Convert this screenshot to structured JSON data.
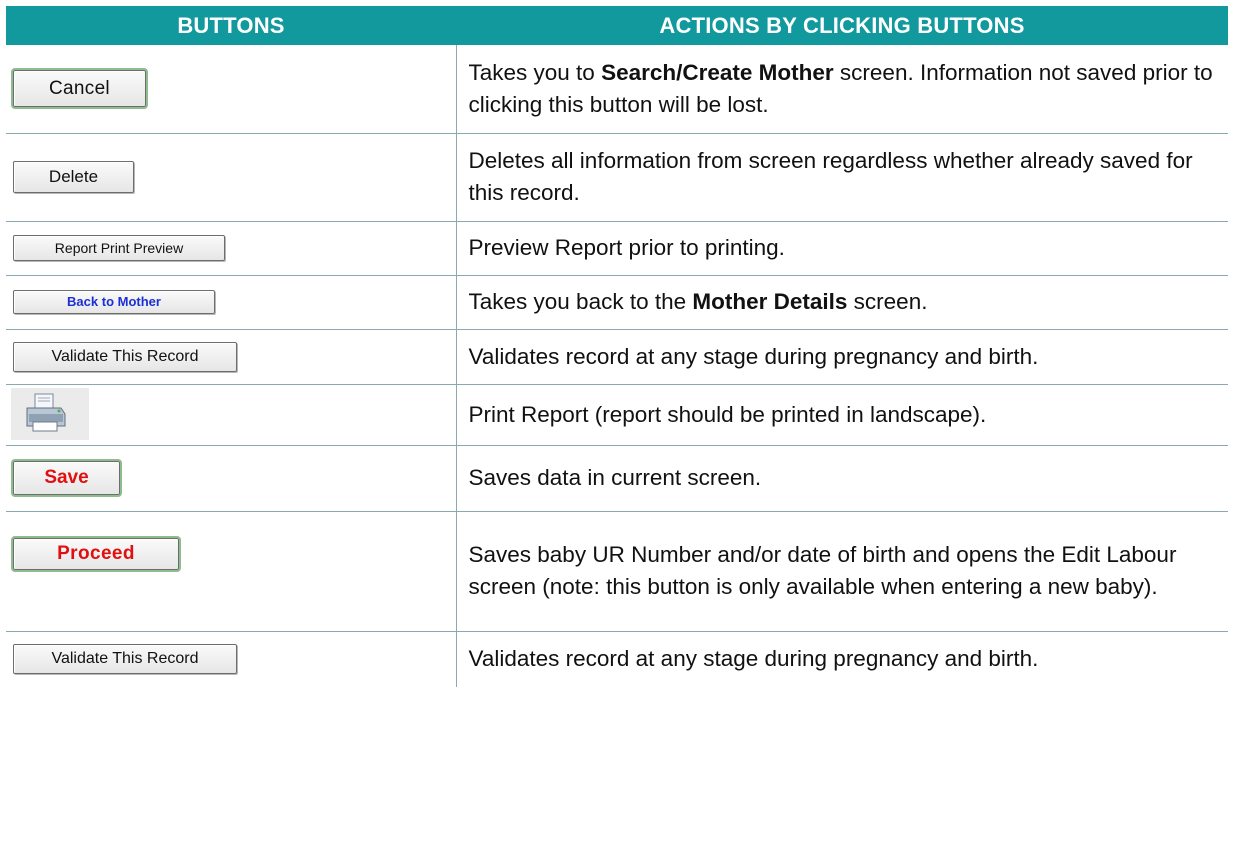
{
  "headers": {
    "buttons": "BUTTONS",
    "actions": "ACTIONS BY CLICKING BUTTONS"
  },
  "rows": [
    {
      "button_label": "Cancel",
      "icon": null,
      "action": {
        "pre": "Takes you to ",
        "bold": "Search/Create Mother",
        "post": " screen. Information not saved prior to clicking this button will be lost."
      }
    },
    {
      "button_label": "Delete",
      "action": {
        "pre": "Deletes all information from screen regardless whether already saved for this record.",
        "bold": "",
        "post": ""
      }
    },
    {
      "button_label": "Report Print Preview",
      "action": {
        "pre": "Preview Report prior to printing.",
        "bold": "",
        "post": ""
      }
    },
    {
      "button_label": "Back to Mother",
      "action": {
        "pre": "Takes you back to the ",
        "bold": "Mother Details",
        "post": " screen."
      }
    },
    {
      "button_label": "Validate This Record",
      "action": {
        "pre": "Validates record at any stage during pregnancy and birth.",
        "bold": "",
        "post": ""
      }
    },
    {
      "button_label": "",
      "icon": "printer-icon",
      "action": {
        "pre": "Print Report (report should be printed in landscape).",
        "bold": "",
        "post": ""
      }
    },
    {
      "button_label": "Save",
      "action": {
        "pre": "Saves data in current screen.",
        "bold": "",
        "post": ""
      }
    },
    {
      "button_label": "Proceed",
      "action": {
        "pre": "Saves baby UR Number and/or date of birth and opens the Edit Labour screen (note: this button is only available when entering a new baby).",
        "bold": "",
        "post": ""
      }
    },
    {
      "button_label": "Validate This Record",
      "action": {
        "pre": "Validates record at any stage during pregnancy and birth.",
        "bold": "",
        "post": ""
      }
    }
  ],
  "colors": {
    "header_bg": "#11999e",
    "header_text": "#ffffff",
    "save_proceed_text": "#e01010",
    "back_to_mother_text": "#1a2fd6"
  }
}
